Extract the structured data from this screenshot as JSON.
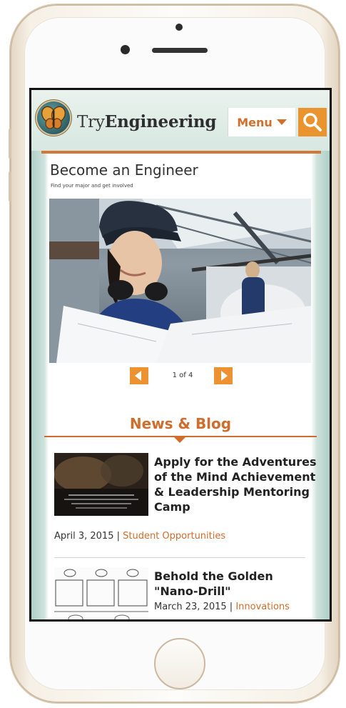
{
  "device": {
    "model": "smartphone",
    "frame_color": "#f3ece1"
  },
  "header": {
    "brand_regular": "Try",
    "brand_bold": "Engineering",
    "menu_label": "Menu",
    "icons": {
      "logo": "butterfly-logo-icon",
      "menu_arrow": "caret-down-icon",
      "search": "search-icon"
    }
  },
  "hero": {
    "title": "Become an Engineer",
    "subtitle": "Find your major and get involved",
    "slide_counter": "1 of 4",
    "icons": {
      "prev": "arrow-left-icon",
      "next": "arrow-right-icon"
    }
  },
  "news": {
    "heading": "News & Blog",
    "posts": [
      {
        "title": "Apply for the Adventures of the Mind Achievement & Leadership Mentoring Camp",
        "date": "April 3, 2015",
        "separator": " | ",
        "category": "Student Opportunities"
      },
      {
        "title": "Behold the Golden \"Nano-Drill\"",
        "date": "March 23, 2015",
        "separator": " | ",
        "category": "Innovations"
      }
    ]
  },
  "colors": {
    "accent": "#cf6d2d",
    "search_bg": "#e9942f",
    "slider_arrow": "#ec9230"
  }
}
